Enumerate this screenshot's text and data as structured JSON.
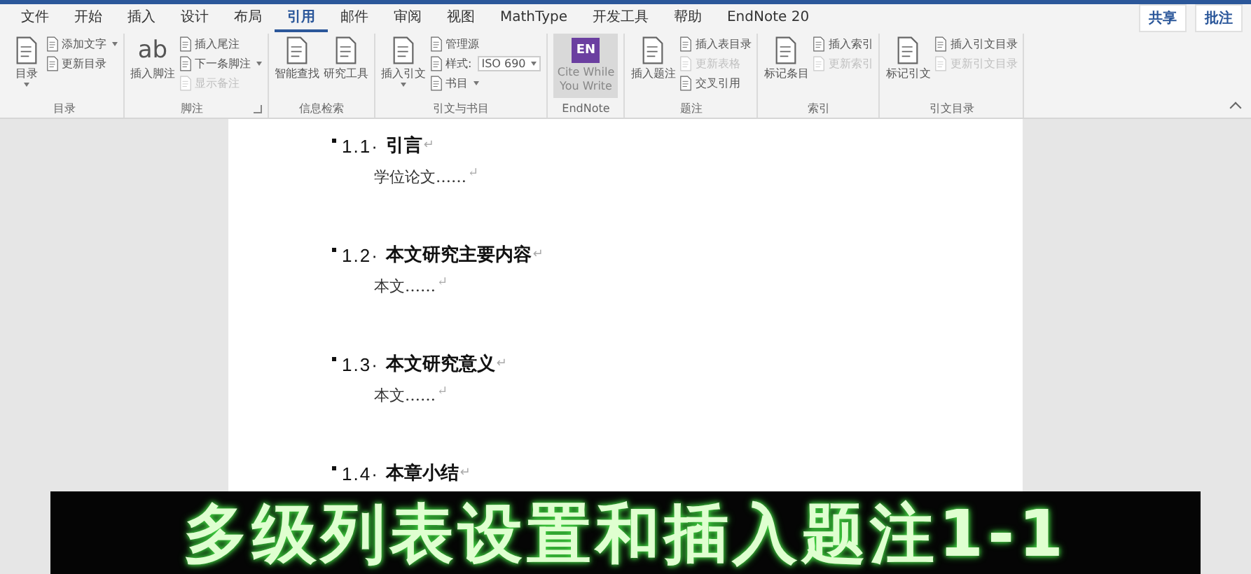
{
  "tabs": [
    {
      "label": "文件",
      "selected": false
    },
    {
      "label": "开始",
      "selected": false
    },
    {
      "label": "插入",
      "selected": false
    },
    {
      "label": "设计",
      "selected": false
    },
    {
      "label": "布局",
      "selected": false
    },
    {
      "label": "引用",
      "selected": true
    },
    {
      "label": "邮件",
      "selected": false
    },
    {
      "label": "审阅",
      "selected": false
    },
    {
      "label": "视图",
      "selected": false
    },
    {
      "label": "MathType",
      "selected": false
    },
    {
      "label": "开发工具",
      "selected": false
    },
    {
      "label": "帮助",
      "selected": false
    },
    {
      "label": "EndNote 20",
      "selected": false
    }
  ],
  "share_button": "共享",
  "comments_button": "批注",
  "ribbon_groups": [
    {
      "label": "目录",
      "launcher": false,
      "items": [
        {
          "kind": "big",
          "label": "目录",
          "has_menu": true,
          "disabled": false
        },
        {
          "kind": "small",
          "label": "添加文字",
          "has_menu": true,
          "disabled": false
        },
        {
          "kind": "small",
          "label": "更新目录",
          "has_menu": false,
          "disabled": false
        }
      ]
    },
    {
      "label": "脚注",
      "launcher": true,
      "items": [
        {
          "kind": "big",
          "label": "插入脚注",
          "has_menu": false,
          "disabled": false,
          "glyph": "ab"
        },
        {
          "kind": "small",
          "label": "插入尾注",
          "has_menu": false,
          "disabled": false
        },
        {
          "kind": "small",
          "label": "下一条脚注",
          "has_menu": true,
          "disabled": false
        },
        {
          "kind": "small",
          "label": "显示备注",
          "has_menu": false,
          "disabled": true
        }
      ]
    },
    {
      "label": "信息检索",
      "launcher": false,
      "items": [
        {
          "kind": "big",
          "label": "智能查找",
          "has_menu": false,
          "disabled": false
        },
        {
          "kind": "big",
          "label": "研究工具",
          "has_menu": false,
          "disabled": false
        }
      ]
    },
    {
      "label": "引文与书目",
      "launcher": false,
      "items": [
        {
          "kind": "big",
          "label": "插入引文",
          "has_menu": true,
          "disabled": false
        },
        {
          "kind": "small",
          "label": "管理源",
          "has_menu": false,
          "disabled": false
        },
        {
          "kind": "style",
          "label": "样式:",
          "value": "ISO 690",
          "has_menu": true,
          "disabled": false
        },
        {
          "kind": "small",
          "label": "书目",
          "has_menu": true,
          "disabled": false
        }
      ]
    },
    {
      "label": "EndNote",
      "launcher": false,
      "items": [
        {
          "kind": "endnote",
          "label": "Cite While You Write",
          "badge": "EN",
          "has_menu": false,
          "disabled": false
        }
      ]
    },
    {
      "label": "题注",
      "launcher": false,
      "items": [
        {
          "kind": "big",
          "label": "插入题注",
          "has_menu": false,
          "disabled": false
        },
        {
          "kind": "small",
          "label": "插入表目录",
          "has_menu": false,
          "disabled": false
        },
        {
          "kind": "small",
          "label": "更新表格",
          "has_menu": false,
          "disabled": true
        },
        {
          "kind": "small",
          "label": "交叉引用",
          "has_menu": false,
          "disabled": false
        }
      ]
    },
    {
      "label": "索引",
      "launcher": false,
      "items": [
        {
          "kind": "big",
          "label": "标记条目",
          "has_menu": false,
          "disabled": false
        },
        {
          "kind": "small",
          "label": "插入索引",
          "has_menu": false,
          "disabled": false
        },
        {
          "kind": "small",
          "label": "更新索引",
          "has_menu": false,
          "disabled": true
        }
      ]
    },
    {
      "label": "引文目录",
      "launcher": false,
      "items": [
        {
          "kind": "big",
          "label": "标记引文",
          "has_menu": false,
          "disabled": false
        },
        {
          "kind": "small",
          "label": "插入引文目录",
          "has_menu": false,
          "disabled": false
        },
        {
          "kind": "small",
          "label": "更新引文目录",
          "has_menu": false,
          "disabled": true
        }
      ]
    }
  ],
  "document": [
    {
      "kind": "heading",
      "number": "1.1·",
      "text": "引言",
      "mark": "↵"
    },
    {
      "kind": "body",
      "text": "学位论文……",
      "mark": "↵"
    },
    {
      "kind": "heading",
      "number": "1.2·",
      "text": "本文研究主要内容",
      "mark": "↵"
    },
    {
      "kind": "body",
      "text": "本文……",
      "mark": "↵"
    },
    {
      "kind": "heading",
      "number": "1.3·",
      "text": "本文研究意义",
      "mark": "↵"
    },
    {
      "kind": "body",
      "text": "本文……",
      "mark": "↵"
    },
    {
      "kind": "heading",
      "number": "1.4·",
      "text": "本章小结",
      "mark": "↵"
    }
  ],
  "caption": "多级列表设置和插入题注1-1"
}
